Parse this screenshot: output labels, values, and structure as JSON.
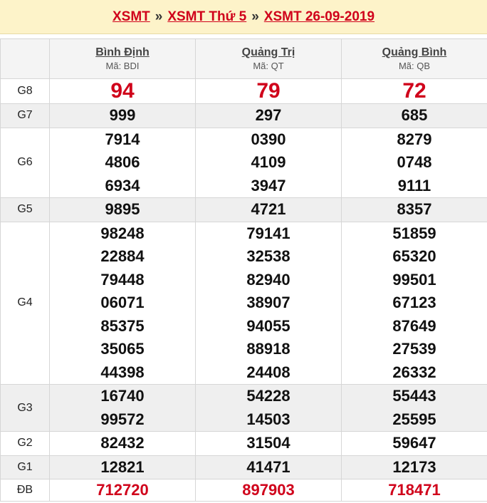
{
  "breadcrumb": {
    "items": [
      "XSMT",
      "XSMT Thứ 5",
      "XSMT 26-09-2019"
    ],
    "separator": "»"
  },
  "provinces": [
    {
      "name": "Bình Định",
      "code": "Mã: BDI"
    },
    {
      "name": "Quảng Trị",
      "code": "Mã: QT"
    },
    {
      "name": "Quảng Bình",
      "code": "Mã: QB"
    }
  ],
  "prizes": [
    {
      "label": "G8",
      "values": [
        [
          "94"
        ],
        [
          "79"
        ],
        [
          "72"
        ]
      ]
    },
    {
      "label": "G7",
      "values": [
        [
          "999"
        ],
        [
          "297"
        ],
        [
          "685"
        ]
      ]
    },
    {
      "label": "G6",
      "values": [
        [
          "7914",
          "4806",
          "6934"
        ],
        [
          "0390",
          "4109",
          "3947"
        ],
        [
          "8279",
          "0748",
          "9111"
        ]
      ]
    },
    {
      "label": "G5",
      "values": [
        [
          "9895"
        ],
        [
          "4721"
        ],
        [
          "8357"
        ]
      ]
    },
    {
      "label": "G4",
      "values": [
        [
          "98248",
          "22884",
          "79448",
          "06071",
          "85375",
          "35065",
          "44398"
        ],
        [
          "79141",
          "32538",
          "82940",
          "38907",
          "94055",
          "88918",
          "24408"
        ],
        [
          "51859",
          "65320",
          "99501",
          "67123",
          "87649",
          "27539",
          "26332"
        ]
      ]
    },
    {
      "label": "G3",
      "values": [
        [
          "16740",
          "99572"
        ],
        [
          "54228",
          "14503"
        ],
        [
          "55443",
          "25595"
        ]
      ]
    },
    {
      "label": "G2",
      "values": [
        [
          "82432"
        ],
        [
          "31504"
        ],
        [
          "59647"
        ]
      ]
    },
    {
      "label": "G1",
      "values": [
        [
          "12821"
        ],
        [
          "41471"
        ],
        [
          "12173"
        ]
      ]
    },
    {
      "label": "ĐB",
      "values": [
        [
          "712720"
        ],
        [
          "897903"
        ],
        [
          "718471"
        ]
      ]
    }
  ],
  "colors": {
    "accent_red": "#d0021b",
    "header_bg": "#fdf3c9",
    "row_gray": "#efefef"
  }
}
